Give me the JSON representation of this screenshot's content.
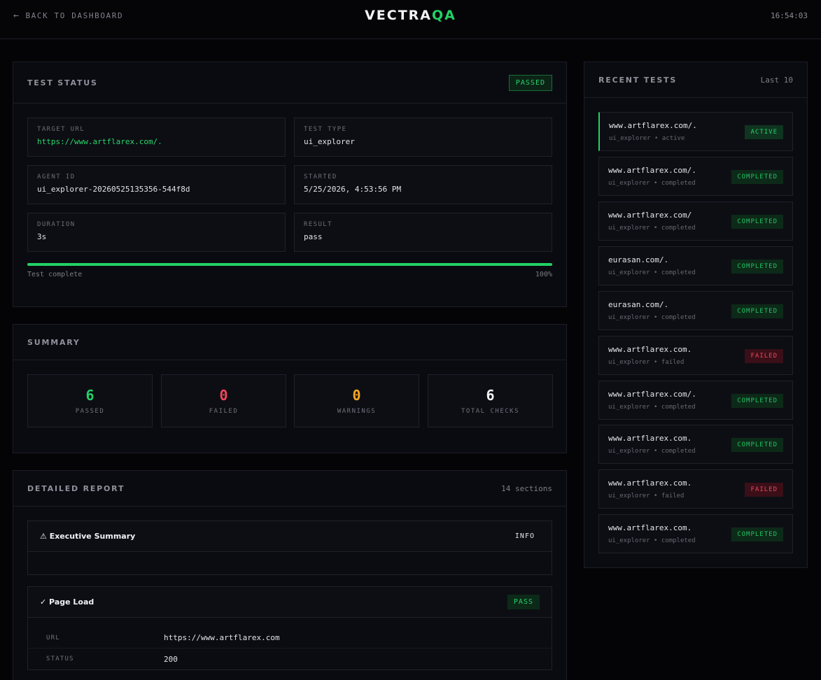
{
  "header": {
    "back_label": "BACK TO DASHBOARD",
    "logo_main": "VECTRA",
    "logo_accent": "QA",
    "clock": "16:54:03"
  },
  "status": {
    "title": "TEST STATUS",
    "badge": "PASSED",
    "fields": {
      "target_url": {
        "label": "TARGET URL",
        "value": "https://www.artflarex.com/."
      },
      "test_type": {
        "label": "TEST TYPE",
        "value": "ui_explorer"
      },
      "agent_id": {
        "label": "AGENT ID",
        "value": "ui_explorer-20260525135356-544f8d"
      },
      "started": {
        "label": "STARTED",
        "value": "5/25/2026, 4:53:56 PM"
      },
      "duration": {
        "label": "DURATION",
        "value": "3s"
      },
      "result": {
        "label": "RESULT",
        "value": "pass"
      }
    },
    "progress_label": "Test complete",
    "progress_percent": "100%",
    "progress_fraction": 1.0
  },
  "summary": {
    "title": "SUMMARY",
    "stats": [
      {
        "value": "6",
        "label": "PASSED",
        "color": "#22d165"
      },
      {
        "value": "0",
        "label": "FAILED",
        "color": "#f0455c"
      },
      {
        "value": "0",
        "label": "WARNINGS",
        "color": "#f5a524"
      },
      {
        "value": "6",
        "label": "TOTAL CHECKS",
        "color": "#f2f3f5"
      }
    ]
  },
  "report": {
    "title": "DETAILED REPORT",
    "count": "14 sections",
    "sections": [
      {
        "icon": "warning-icon",
        "title": "⚠ Executive Summary",
        "badge": "INFO"
      },
      {
        "icon": "check-icon",
        "title": "✓ Page Load",
        "badge": "PASS",
        "rows": [
          {
            "key": "URL",
            "value": "https://www.artflarex.com"
          },
          {
            "key": "STATUS",
            "value": "200"
          }
        ]
      }
    ]
  },
  "recent": {
    "title": "RECENT TESTS",
    "subtitle": "Last 10",
    "items": [
      {
        "host": "www.artflarex.com/.",
        "meta": "ui_explorer • active",
        "status": "ACTIVE",
        "kind": "active"
      },
      {
        "host": "www.artflarex.com/.",
        "meta": "ui_explorer • completed",
        "status": "COMPLETED",
        "kind": "completed"
      },
      {
        "host": "www.artflarex.com/",
        "meta": "ui_explorer • completed",
        "status": "COMPLETED",
        "kind": "completed"
      },
      {
        "host": "eurasan.com/.",
        "meta": "ui_explorer • completed",
        "status": "COMPLETED",
        "kind": "completed"
      },
      {
        "host": "eurasan.com/.",
        "meta": "ui_explorer • completed",
        "status": "COMPLETED",
        "kind": "completed"
      },
      {
        "host": "www.artflarex.com.",
        "meta": "ui_explorer • failed",
        "status": "FAILED",
        "kind": "failed"
      },
      {
        "host": "www.artflarex.com/.",
        "meta": "ui_explorer • completed",
        "status": "COMPLETED",
        "kind": "completed"
      },
      {
        "host": "www.artflarex.com.",
        "meta": "ui_explorer • completed",
        "status": "COMPLETED",
        "kind": "completed"
      },
      {
        "host": "www.artflarex.com.",
        "meta": "ui_explorer • failed",
        "status": "FAILED",
        "kind": "failed"
      },
      {
        "host": "www.artflarex.com.",
        "meta": "ui_explorer • completed",
        "status": "COMPLETED",
        "kind": "completed"
      }
    ]
  }
}
